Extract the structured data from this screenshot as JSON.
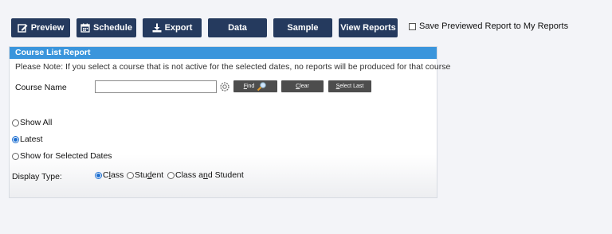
{
  "toolbar": {
    "preview": "Preview",
    "schedule": "Schedule",
    "export": "Export",
    "data": "Data",
    "sample": "Sample",
    "view_reports": "View Reports"
  },
  "save_option": {
    "label": "Save Previewed Report to My Reports",
    "checked": false
  },
  "panel": {
    "title": "Course List Report",
    "note": "Please Note: If you select a course that is not active for the selected dates, no reports will be produced for that course",
    "course_name_label": "Course Name",
    "course_name_value": "",
    "find": {
      "pre": "",
      "key": "F",
      "post": "ind"
    },
    "clear": {
      "pre": "",
      "key": "C",
      "post": "lear"
    },
    "select_last": {
      "pre": "",
      "key": "S",
      "post": "elect Last"
    },
    "date_options": [
      {
        "label": "Show All",
        "selected": false
      },
      {
        "label": "Latest",
        "selected": true
      },
      {
        "label": "Show for Selected Dates",
        "selected": false
      }
    ],
    "display_type_label": "Display Type:",
    "display_options": [
      {
        "pre": "C",
        "key": "l",
        "post": "ass",
        "selected": true
      },
      {
        "pre": "Stu",
        "key": "d",
        "post": "ent",
        "selected": false
      },
      {
        "pre": "Class a",
        "key": "n",
        "post": "d Student",
        "selected": false
      }
    ]
  },
  "colors": {
    "toolbar_bg": "#253a5e",
    "panel_header": "#3a95dc",
    "small_button": "#4d4d4d",
    "radio_selected": "#1d6fd1"
  }
}
